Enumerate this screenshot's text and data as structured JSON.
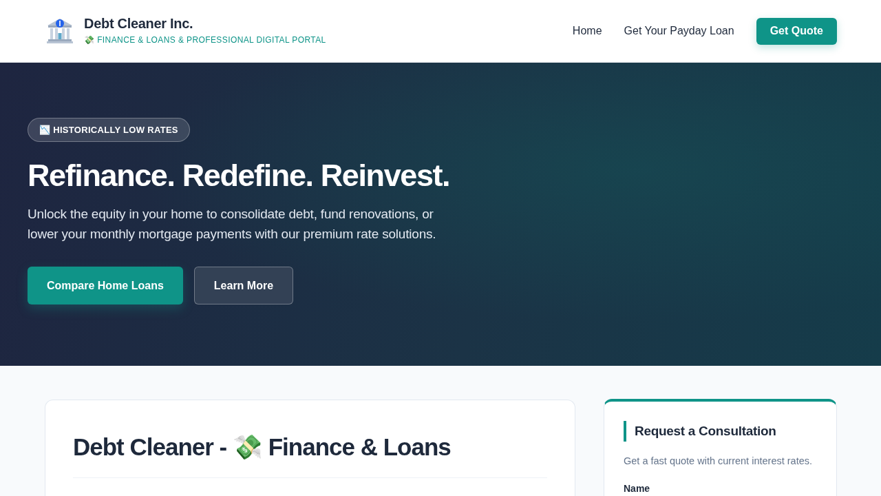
{
  "header": {
    "brand": {
      "title": "Debt Cleaner Inc.",
      "tagline": "💸 FINANCE & LOANS & PROFESSIONAL DIGITAL PORTAL"
    },
    "nav": [
      {
        "label": "Home"
      },
      {
        "label": "Get Your Payday Loan"
      }
    ],
    "cta": "Get Quote"
  },
  "hero": {
    "badge": "📉 HISTORICALLY LOW RATES",
    "title": "Refinance. Redefine. Reinvest.",
    "text": "Unlock the equity in your home to consolidate debt, fund renovations, or lower your monthly mortgage payments with our premium rate solutions.",
    "buttons": [
      {
        "label": "Compare Home Loans",
        "kind": "primary"
      },
      {
        "label": "Learn More",
        "kind": "secondary"
      }
    ]
  },
  "article": {
    "title": "Debt Cleaner - 💸 Finance & Loans"
  },
  "consultation": {
    "title": "Request a Consultation",
    "subtitle": "Get a fast quote with current interest rates.",
    "fields": [
      {
        "label": "Name"
      }
    ]
  }
}
